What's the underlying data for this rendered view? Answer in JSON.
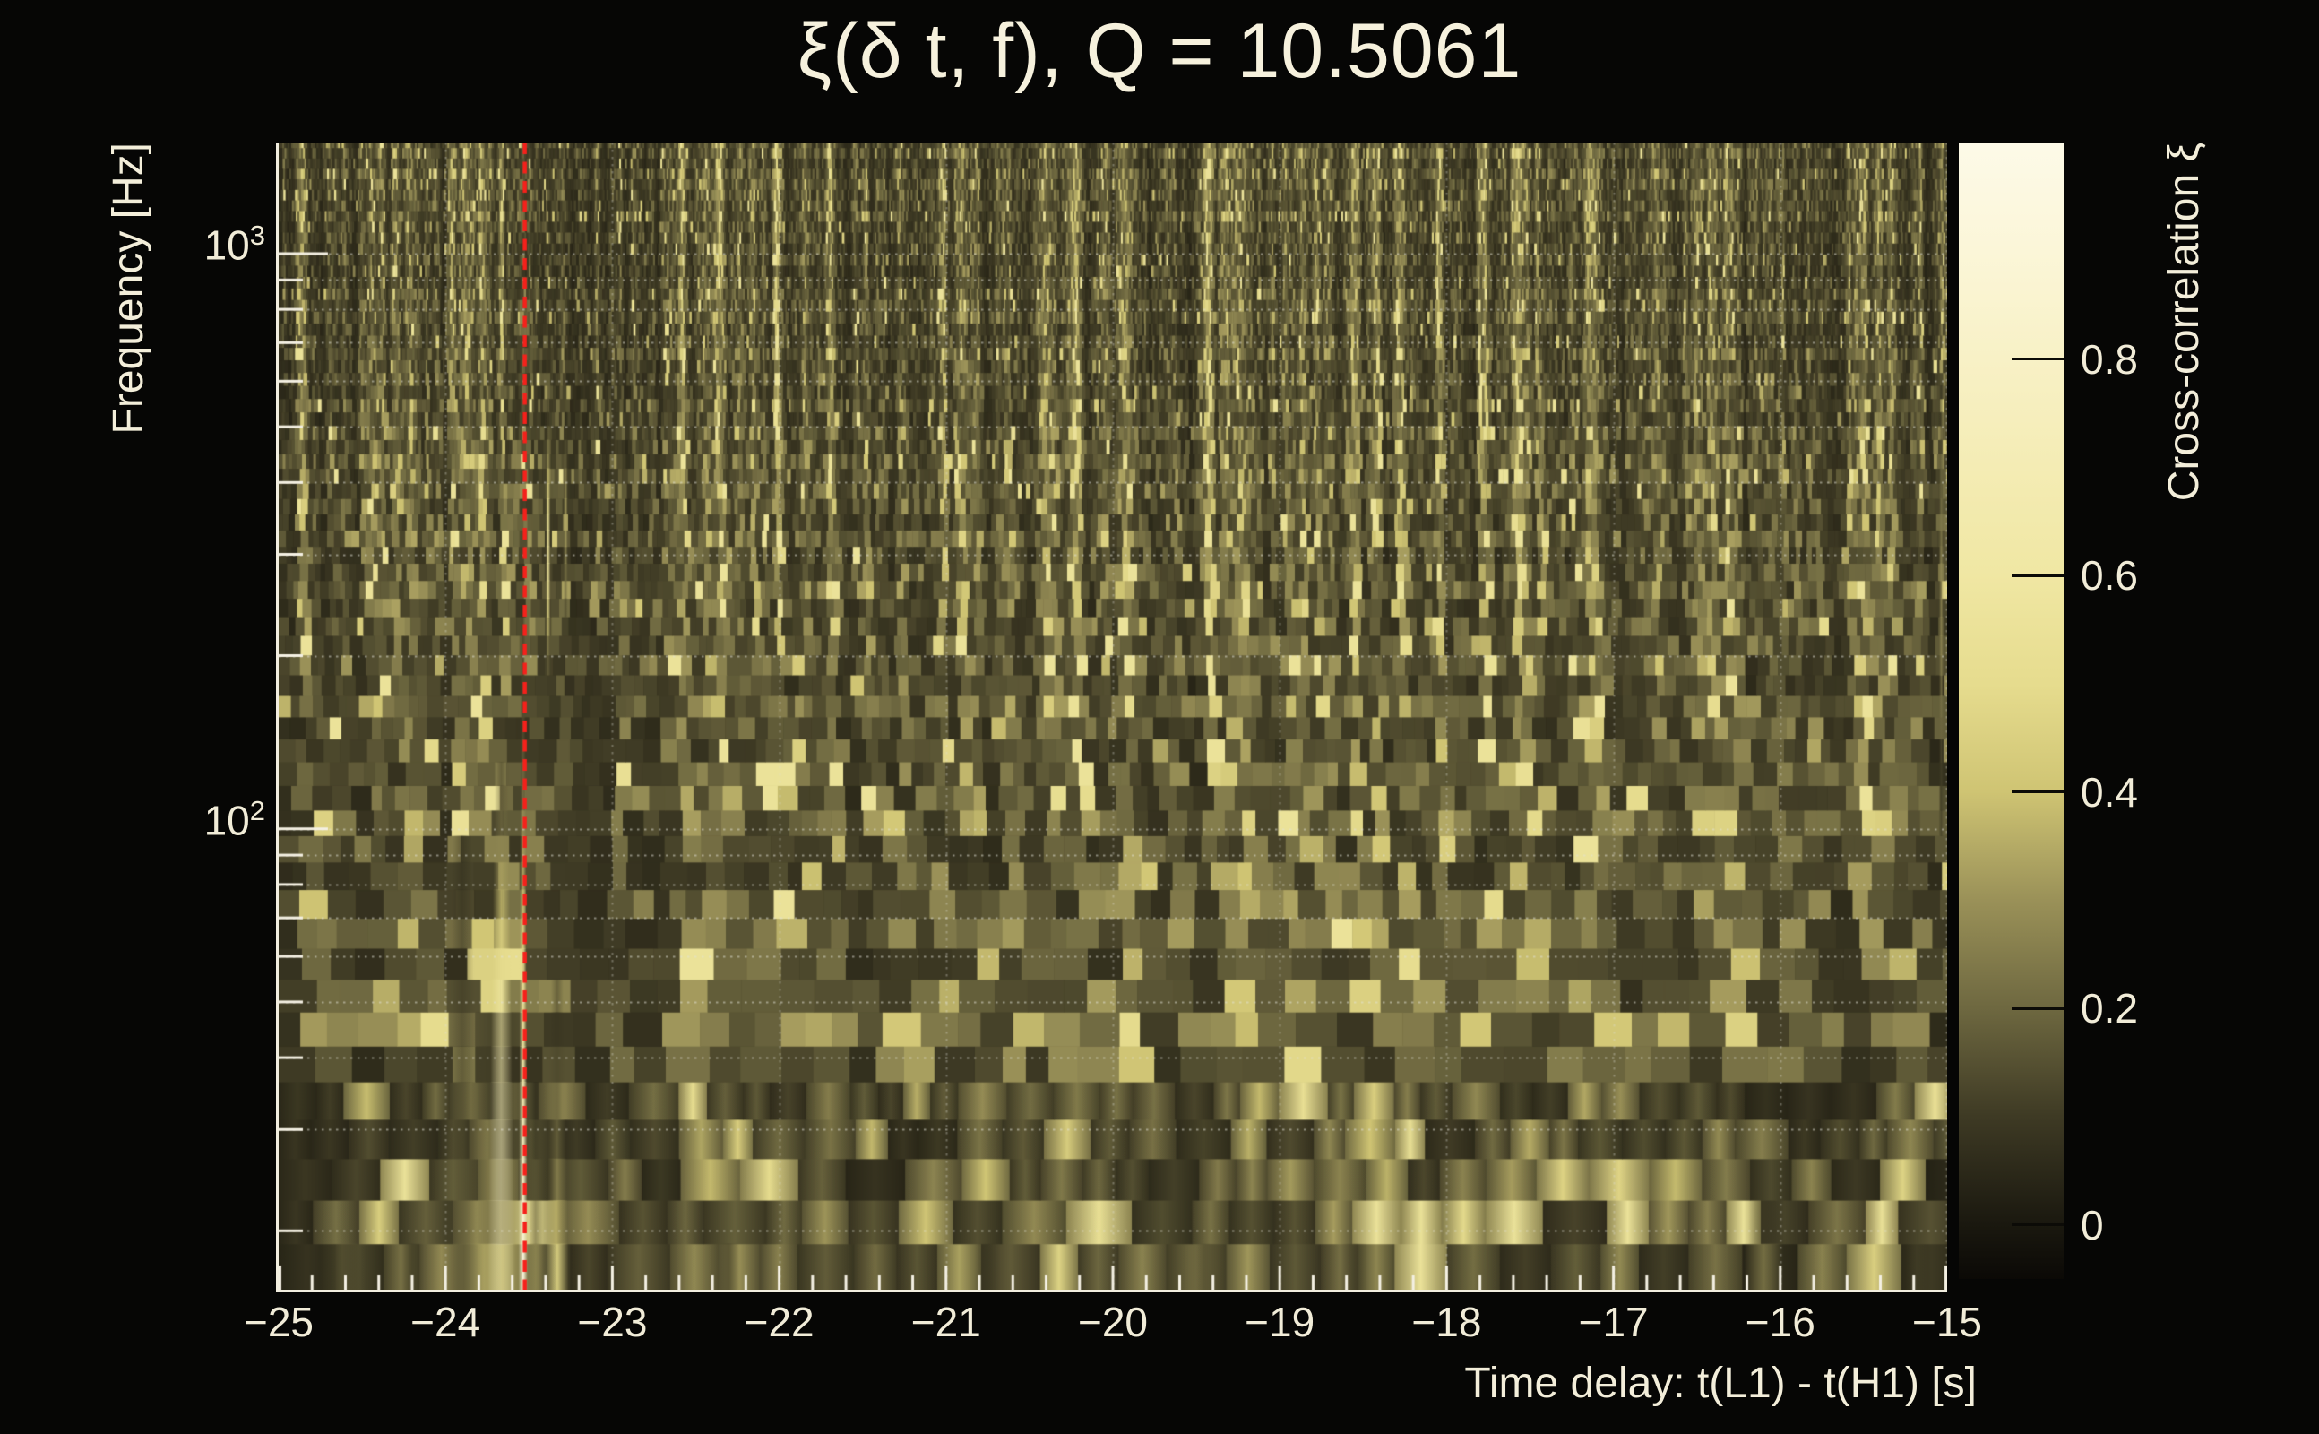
{
  "title": "ξ(δ t, f), Q = 10.5061",
  "y_axis": {
    "title": "Frequency [Hz]",
    "tick_labels": [
      {
        "mantissa": "10",
        "exponent": "3",
        "value_hz": 1000
      },
      {
        "mantissa": "10",
        "exponent": "2",
        "value_hz": 100
      }
    ]
  },
  "x_axis": {
    "title": "Time delay: t(L1) - t(H1) [s]",
    "ticks": [
      {
        "label": "−25",
        "value": -25
      },
      {
        "label": "−24",
        "value": -24
      },
      {
        "label": "−23",
        "value": -23
      },
      {
        "label": "−22",
        "value": -22
      },
      {
        "label": "−21",
        "value": -21
      },
      {
        "label": "−20",
        "value": -20
      },
      {
        "label": "−19",
        "value": -19
      },
      {
        "label": "−18",
        "value": -18
      },
      {
        "label": "−17",
        "value": -17
      },
      {
        "label": "−16",
        "value": -16
      },
      {
        "label": "−15",
        "value": -15
      }
    ]
  },
  "colorbar": {
    "title": "Cross-correlation ξ",
    "ticks": [
      {
        "label": "0.8",
        "value": 0.8
      },
      {
        "label": "0.6",
        "value": 0.6
      },
      {
        "label": "0.4",
        "value": 0.4
      },
      {
        "label": "0.2",
        "value": 0.2
      },
      {
        "label": "0",
        "value": 0.0
      }
    ],
    "value_range": [
      -0.05,
      1.0
    ]
  },
  "colors": {
    "background": "#060605",
    "text": "#f3eeda",
    "frame": "#f2eee0",
    "grid": "#e4e4da",
    "marker_line": "#f5211b"
  },
  "chart_data": {
    "type": "heatmap",
    "title": "ξ(δ t, f), Q = 10.5061",
    "q_value": 10.5061,
    "xlabel": "Time delay: t(L1) - t(H1) [s]",
    "ylabel": "Frequency [Hz]",
    "zlabel": "Cross-correlation ξ",
    "x_range_s": [
      -25,
      -15
    ],
    "x_tick_major_s": 1.0,
    "x_tick_minor_s": 0.2,
    "y_scale": "log",
    "y_range_hz": [
      15.8,
      1560
    ],
    "y_major_grid_hz": [
      100,
      1000
    ],
    "y_minor_grid_hz": [
      20,
      30,
      40,
      50,
      60,
      70,
      80,
      90,
      200,
      300,
      400,
      500,
      600,
      700,
      800,
      900
    ],
    "grid": "dotted, horizontal at log minor ticks, vertical at integer seconds",
    "noise_floor_xi": [
      0.0,
      0.18
    ],
    "marker_line": {
      "x_s": -23.525,
      "style": "dashed",
      "color": "#f5211b"
    },
    "peak": {
      "x_s": -23.6,
      "freq_hz": 20,
      "xi": 1.0
    },
    "colormap": [
      [
        -0.05,
        "#0b0906"
      ],
      [
        0.0,
        "#1a180f"
      ],
      [
        0.1,
        "#3e3a24"
      ],
      [
        0.2,
        "#6e6840"
      ],
      [
        0.3,
        "#9a9158"
      ],
      [
        0.4,
        "#cfc473"
      ],
      [
        0.5,
        "#e6dc8e"
      ],
      [
        0.6,
        "#f0e7a3"
      ],
      [
        0.7,
        "#f4ecb4"
      ],
      [
        0.8,
        "#f8f1c6"
      ],
      [
        0.9,
        "#fbf6d8"
      ],
      [
        1.0,
        "#fdfae8"
      ]
    ],
    "features": [
      {
        "name": "main-peak-core",
        "dt": -23.665,
        "f_lo": 15.8,
        "f_hi": 135,
        "half_width_s": 0.085,
        "amp": 1.0,
        "fade": 0.75
      },
      {
        "name": "main-peak-skirt",
        "dt": -23.66,
        "f_lo": 15.8,
        "f_hi": 60,
        "half_width_s": 0.27,
        "amp": 0.42,
        "fade": 1.4
      },
      {
        "name": "delay-line",
        "dt": -23.535,
        "f_lo": 15.8,
        "f_hi": 265,
        "half_width_s": 0.028,
        "amp": 0.98,
        "fade": 1.1
      },
      {
        "name": "pre-peak-columns",
        "dt": -23.9,
        "f_lo": 17,
        "f_hi": 150,
        "half_width_s": 0.1,
        "amp": 0.2,
        "fade": 1.2
      },
      {
        "name": "side-column-right",
        "dt": -23.33,
        "f_lo": 15.8,
        "f_hi": 62,
        "half_width_s": 0.07,
        "amp": 0.5,
        "fade": 1.3
      },
      {
        "name": "side-column-near",
        "dt": -23.46,
        "f_lo": 15.8,
        "f_hi": 40,
        "half_width_s": 0.05,
        "amp": 0.32,
        "fade": 1.3
      },
      {
        "name": "high-streak-1",
        "dt": -23.385,
        "f_lo": 160,
        "f_hi": 580,
        "half_width_s": 0.013,
        "amp": 0.55,
        "profile": "band"
      },
      {
        "name": "high-streak-2",
        "dt": -23.28,
        "f_lo": 220,
        "f_hi": 540,
        "half_width_s": 0.01,
        "amp": 0.35,
        "profile": "band"
      },
      {
        "name": "right-edge-streak",
        "dt": -15.035,
        "f_lo": 90,
        "f_hi": 650,
        "half_width_s": 0.012,
        "amp": 0.3,
        "profile": "band"
      },
      {
        "name": "bottom-smear-a",
        "dt": -24.62,
        "f_lo": 15.8,
        "f_hi": 21,
        "half_width_s": 0.16,
        "amp": 0.33,
        "fade": 1.5
      },
      {
        "name": "bottom-smear-b",
        "dt": -24.2,
        "f_lo": 15.8,
        "f_hi": 19,
        "half_width_s": 0.1,
        "amp": 0.18,
        "fade": 1.5
      },
      {
        "name": "bottom-smear-c",
        "dt": -22.3,
        "f_lo": 15.8,
        "f_hi": 19,
        "half_width_s": 0.09,
        "amp": 0.15,
        "fade": 1.5
      },
      {
        "name": "bottom-smear-d",
        "dt": -20.75,
        "f_lo": 15.8,
        "f_hi": 20,
        "half_width_s": 0.1,
        "amp": 0.16,
        "fade": 1.5
      },
      {
        "name": "bottom-smear-e",
        "dt": -19.45,
        "f_lo": 15.8,
        "f_hi": 22,
        "half_width_s": 0.11,
        "amp": 0.22,
        "fade": 1.5
      },
      {
        "name": "bottom-smear-f",
        "dt": -18.55,
        "f_lo": 15.8,
        "f_hi": 20,
        "half_width_s": 0.1,
        "amp": 0.22,
        "fade": 1.5
      },
      {
        "name": "bottom-smear-g",
        "dt": -16.1,
        "f_lo": 15.8,
        "f_hi": 26,
        "half_width_s": 0.13,
        "amp": 0.38,
        "fade": 1.5
      },
      {
        "name": "bottom-smear-h",
        "dt": -15.18,
        "f_lo": 15.8,
        "f_hi": 20,
        "half_width_s": 0.09,
        "amp": 0.26,
        "fade": 1.5
      }
    ]
  }
}
